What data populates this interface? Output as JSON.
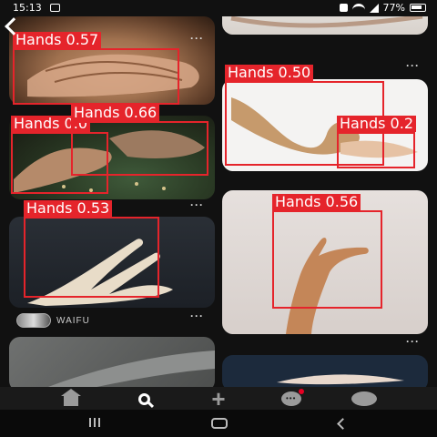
{
  "status_bar": {
    "time": "15:13",
    "battery": "77%"
  },
  "feed": {
    "pins": [
      {
        "id": "pin-1",
        "detections": [
          {
            "label": "Hands 0.57"
          }
        ],
        "menu": "···"
      },
      {
        "id": "pin-2",
        "detections": [],
        "menu": "···"
      },
      {
        "id": "pin-3",
        "detections": [
          {
            "label": "Hands 0.0"
          },
          {
            "label": "Hands 0.66"
          }
        ],
        "menu": "···"
      },
      {
        "id": "pin-4",
        "detections": [
          {
            "label": "Hands 0.50"
          },
          {
            "label": "Hands 0.2"
          }
        ],
        "menu": "···"
      },
      {
        "id": "pin-5",
        "detections": [
          {
            "label": "Hands 0.53"
          }
        ],
        "menu": "···",
        "author": "WAIFU"
      },
      {
        "id": "pin-6",
        "detections": [
          {
            "label": "Hands 0.56"
          }
        ],
        "menu": "···"
      }
    ]
  },
  "bottom_nav": {
    "items": [
      "home-icon",
      "search-icon",
      "create-icon",
      "messages-icon",
      "profile-icon"
    ]
  },
  "system_nav": [
    "recents-icon",
    "home-icon",
    "back-icon"
  ],
  "colors": {
    "detection_box": "#e5242b",
    "notification_dot": "#e60023",
    "background": "#111111"
  }
}
